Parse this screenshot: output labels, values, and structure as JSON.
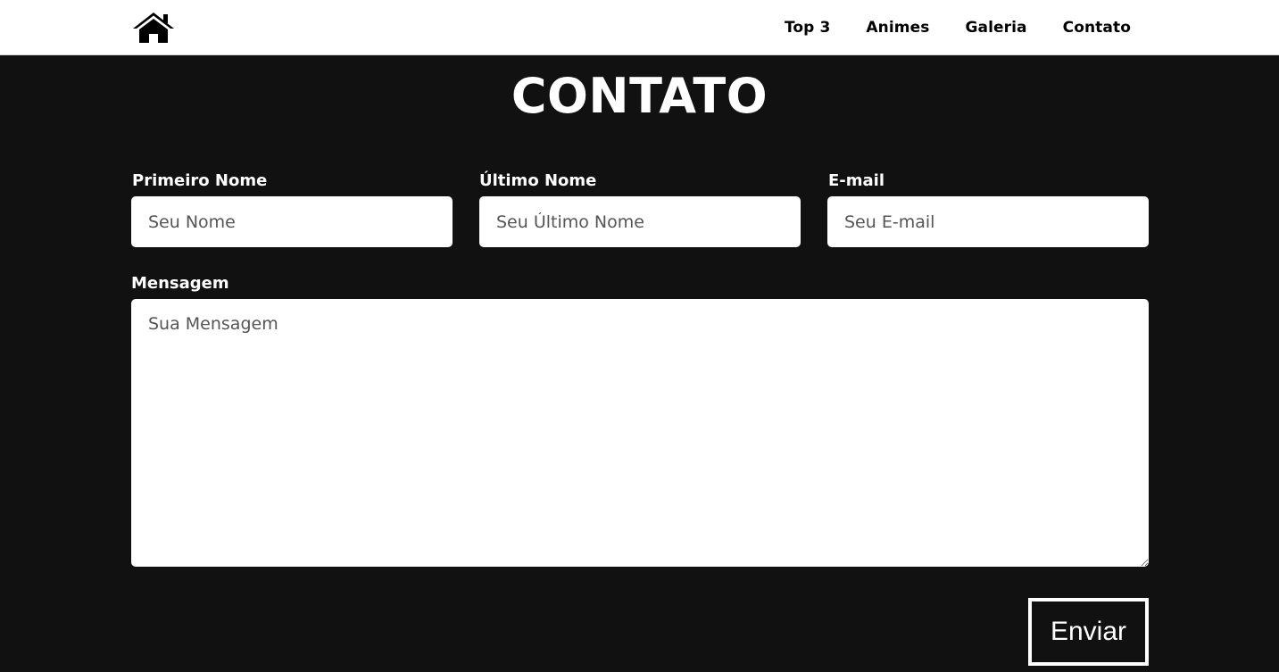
{
  "nav": {
    "home_icon": "home-icon",
    "links": [
      "Top 3",
      "Animes",
      "Galeria",
      "Contato"
    ]
  },
  "page": {
    "title": "CONTATO"
  },
  "form": {
    "first_name": {
      "label": "Primeiro Nome",
      "placeholder": "Seu Nome"
    },
    "last_name": {
      "label": "Último Nome",
      "placeholder": "Seu Último Nome"
    },
    "email": {
      "label": "E-mail",
      "placeholder": "Seu E-mail"
    },
    "message": {
      "label": "Mensagem",
      "placeholder": "Sua Mensagem"
    },
    "submit_label": "Enviar"
  },
  "colors": {
    "background": "#111111",
    "navbar": "#ffffff",
    "text_light": "#ffffff",
    "text_dark": "#000000"
  }
}
